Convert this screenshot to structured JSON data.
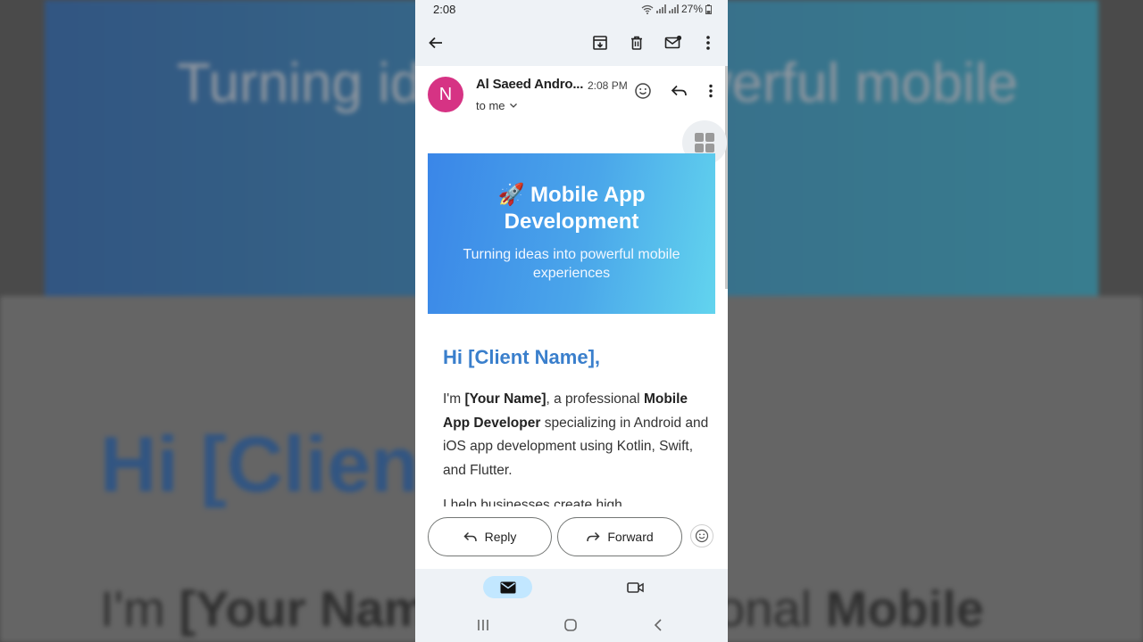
{
  "status": {
    "time": "2:08",
    "battery": "27%"
  },
  "toolbar": {
    "back_icon": "arrow-back-icon",
    "archive_icon": "archive-icon",
    "delete_icon": "trash-icon",
    "mark_unread_icon": "mail-unread-icon",
    "more_icon": "more-vert-icon"
  },
  "email": {
    "avatar_letter": "N",
    "avatar_color": "#d63384",
    "sender": "Al Saeed Andro...",
    "time": "2:08 PM",
    "recipient": "to me",
    "banner": {
      "title_line1": "🚀 Mobile App",
      "title_line2": "Development",
      "subtitle_line1": "Turning ideas into powerful mobile",
      "subtitle_line2": "experiences"
    },
    "greeting": "Hi [Client Name],",
    "para": {
      "t1": "I'm ",
      "b1": "[Your Name]",
      "t2": ", a professional ",
      "b2": "Mobile App Developer",
      "t3": " specializing in Android and iOS app development using Kotlin, Swift, and Flutter."
    },
    "para2": "I help businesses create high"
  },
  "actions": {
    "reply": "Reply",
    "forward": "Forward"
  },
  "background": {
    "banner_text": "Turning ideas into powerful mobile",
    "hi_text": "Hi [Client Name],",
    "body_t1": "I'm ",
    "body_b1": "[Your Name]",
    "body_t2": ", a professional ",
    "body_b2": "Mobile"
  },
  "colors": {
    "accent": "#3a7fcc",
    "nav_active": "#c2e7ff",
    "banner_start": "#3a86e8",
    "banner_end": "#62d4ee"
  }
}
